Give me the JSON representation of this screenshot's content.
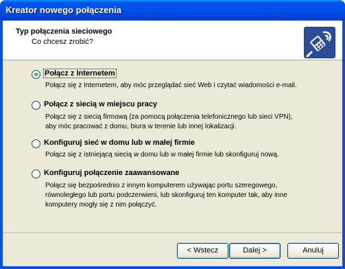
{
  "window": {
    "title": "Kreator nowego połączenia"
  },
  "header": {
    "title": "Typ połączenia sieciowego",
    "subtitle": "Co chcesz zrobić?",
    "icon": "network-connection-icon"
  },
  "options": [
    {
      "label": "Połącz z Internetem",
      "checked": true,
      "description": [
        "Połącz się z Internetem, aby móc przeglądać sieć Web i czytać wiadomości e-mail."
      ]
    },
    {
      "label": "Połącz z siecią w miejscu pracy",
      "checked": false,
      "description": [
        "Połącz się z siecią firmową (za pomocą połączenia telefonicznego lub sieci VPN),",
        "aby móc pracować z domu, biura w terenie lub innej lokalizacji."
      ]
    },
    {
      "label": "Konfiguruj sieć w domu lub w małej firmie",
      "checked": false,
      "description": [
        "Połącz się z istniejącą siecią w domu lub w małej firmie lub skonfiguruj nową."
      ]
    },
    {
      "label": "Konfiguruj połączenie zaawansowane",
      "checked": false,
      "description": [
        "Połącz się bezpośrednio z innym komputerem używając portu szeregowego,",
        "równoległego lub portu podczerwieni, lub skonfiguruj ten komputer tak, aby inne",
        "komputery mogły się z nim połączyć."
      ]
    }
  ],
  "buttons": {
    "back": "< Wstecz",
    "next": "Dalej >",
    "cancel": "Anuluj"
  },
  "colors": {
    "titlebar": "#0053ee",
    "client": "#ece9d8",
    "radio_checked": "#21a121"
  }
}
